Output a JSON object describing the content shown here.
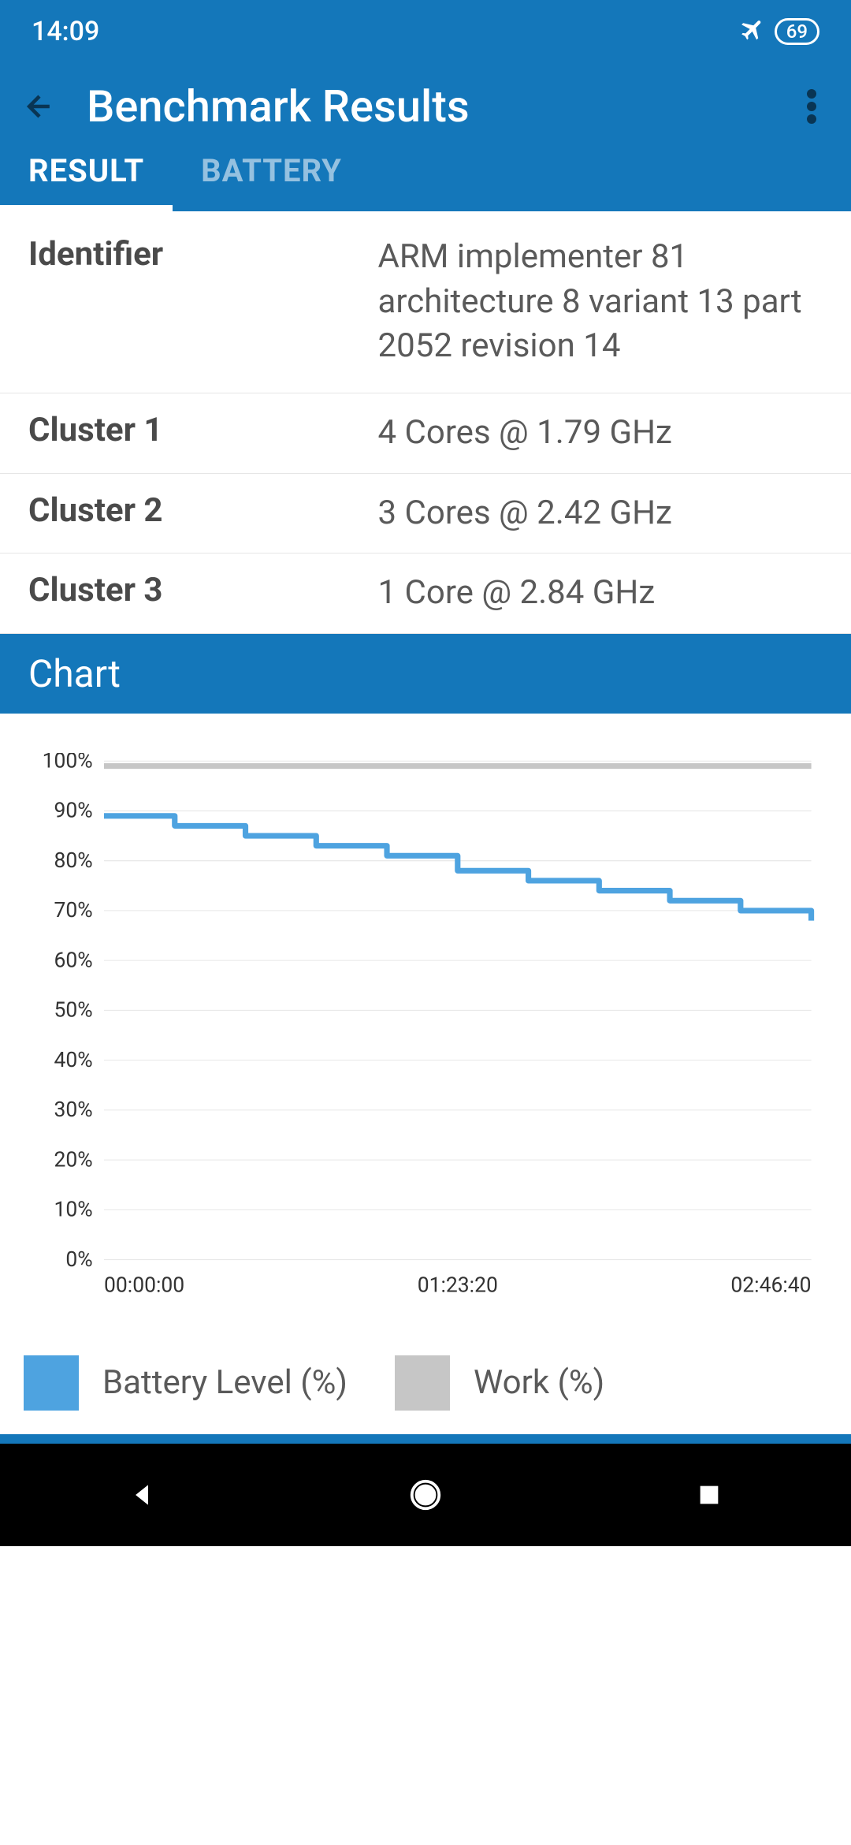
{
  "status": {
    "time": "14:09",
    "battery": "69"
  },
  "appbar": {
    "title": "Benchmark Results"
  },
  "tabs": {
    "result": "RESULT",
    "battery": "BATTERY"
  },
  "info": {
    "rows": [
      {
        "label": "Identifier",
        "value": "ARM implementer 81 architecture 8 variant 13 part 2052 revision 14"
      },
      {
        "label": "Cluster 1",
        "value": "4 Cores @ 1.79 GHz"
      },
      {
        "label": "Cluster 2",
        "value": "3 Cores @ 2.42 GHz"
      },
      {
        "label": "Cluster 3",
        "value": "1 Core @ 2.84 GHz"
      }
    ]
  },
  "section": {
    "chart_title": "Chart"
  },
  "chart_data": {
    "type": "line",
    "xlabel": "",
    "ylabel": "",
    "ylim": [
      0,
      100
    ],
    "y_ticks": [
      "100%",
      "90%",
      "80%",
      "70%",
      "60%",
      "50%",
      "40%",
      "30%",
      "20%",
      "10%",
      "0%"
    ],
    "x_ticks": [
      "00:00:00",
      "01:23:20",
      "02:46:40"
    ],
    "series": [
      {
        "name": "Battery Level (%)",
        "color": "#4ea3e0",
        "x": [
          "00:00:00",
          "00:16:40",
          "00:33:20",
          "00:50:00",
          "01:06:40",
          "01:23:20",
          "01:40:00",
          "01:56:40",
          "02:13:20",
          "02:30:00",
          "02:46:40"
        ],
        "values": [
          89,
          87,
          85,
          83,
          81,
          78,
          76,
          74,
          72,
          70,
          68
        ]
      },
      {
        "name": "Work (%)",
        "color": "#c6c6c6",
        "x": [
          "00:00:00",
          "02:46:40"
        ],
        "values": [
          99,
          99
        ]
      }
    ]
  },
  "legend": {
    "battery": "Battery Level (%)",
    "work": "Work (%)"
  }
}
